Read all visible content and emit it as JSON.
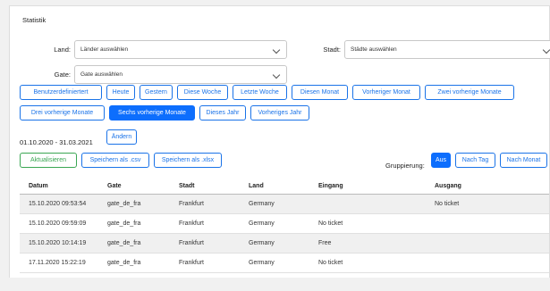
{
  "panel": {
    "title": "Statistik"
  },
  "filters": {
    "land": {
      "label": "Land:",
      "value": "Länder auswählen"
    },
    "stadt": {
      "label": "Stadt:",
      "value": "Städte auswählen"
    },
    "gate": {
      "label": "Gate:",
      "value": "Gate auswählen"
    }
  },
  "ranges": [
    {
      "label": "Benutzerdefiniertert",
      "active": false
    },
    {
      "label": "Heute",
      "active": false
    },
    {
      "label": "Gestern",
      "active": false
    },
    {
      "label": "Diese Woche",
      "active": false
    },
    {
      "label": "Letzte Woche",
      "active": false
    },
    {
      "label": "Diesen Monat",
      "active": false
    },
    {
      "label": "Vorheriger Monat",
      "active": false
    },
    {
      "label": "Zwei vorherige Monate",
      "active": false
    },
    {
      "label": "Drei vorherige Monate",
      "active": false
    },
    {
      "label": "Sechs vorherige Monate",
      "active": true
    },
    {
      "label": "Dieses Jahr",
      "active": false
    },
    {
      "label": "Vorheriges Jahr",
      "active": false
    }
  ],
  "date_range": {
    "text": "01.10.2020 - 31.03.2021",
    "change_label": "Ändern"
  },
  "actions": {
    "refresh": "Aktualisieren",
    "save_csv": "Speichern als .csv",
    "save_xlsx": "Speichern als .xlsx"
  },
  "grouping": {
    "label": "Gruppierung:",
    "options": [
      "Aus",
      "Nach Tag",
      "Nach Monat"
    ],
    "selected": "Aus"
  },
  "table": {
    "headers": [
      "Datum",
      "Gate",
      "Stadt",
      "Land",
      "Eingang",
      "Ausgang"
    ],
    "rows": [
      [
        "15.10.2020 09:53:54",
        "gate_de_fra",
        "Frankfurt",
        "Germany",
        "",
        "No ticket"
      ],
      [
        "15.10.2020 09:59:09",
        "gate_de_fra",
        "Frankfurt",
        "Germany",
        "No ticket",
        ""
      ],
      [
        "15.10.2020 10:14:19",
        "gate_de_fra",
        "Frankfurt",
        "Germany",
        "Free",
        ""
      ],
      [
        "17.11.2020 15:22:19",
        "gate_de_fra",
        "Frankfurt",
        "Germany",
        "No ticket",
        ""
      ]
    ]
  },
  "colors": {
    "accent": "#1a73e8",
    "active": "#0d6efd",
    "success": "#3aa653"
  }
}
